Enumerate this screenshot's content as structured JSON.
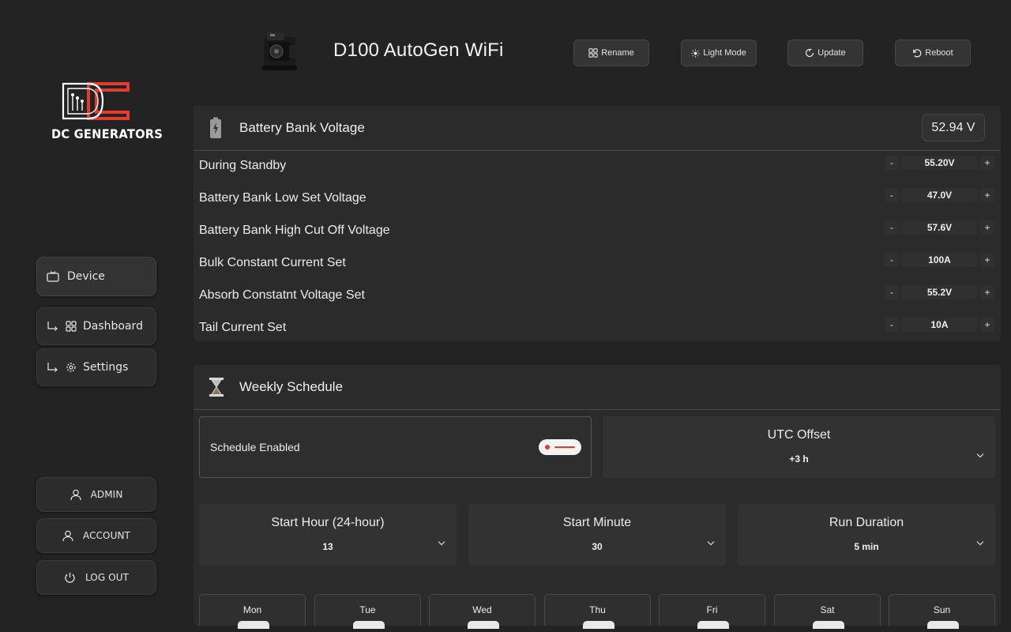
{
  "brand": {
    "name": "DC GENERATORS"
  },
  "nav": {
    "items": [
      {
        "label": "Device",
        "icon": "tv-icon"
      },
      {
        "label": "Dashboard",
        "icon": "grid-icon"
      },
      {
        "label": "Settings",
        "icon": "gear-icon"
      }
    ],
    "account": [
      {
        "label": "ADMIN",
        "icon": "user-icon"
      },
      {
        "label": "ACCOUNT",
        "icon": "user-icon"
      },
      {
        "label": "LOG OUT",
        "icon": "power-icon"
      }
    ]
  },
  "header": {
    "title": "D100 AutoGen WiFi",
    "buttons": [
      {
        "label": "Rename",
        "icon": "grid-icon"
      },
      {
        "label": "Light Mode",
        "icon": "sun-icon"
      },
      {
        "label": "Update",
        "icon": "refresh-icon"
      },
      {
        "label": "Reboot",
        "icon": "undo-icon"
      }
    ]
  },
  "battery": {
    "title": "Battery Bank Voltage",
    "current_voltage": "52.94 V",
    "settings": [
      {
        "label": "During Standby",
        "value": "55.20V"
      },
      {
        "label": "Battery Bank Low Set Voltage",
        "value": "47.0V"
      },
      {
        "label": "Battery Bank High Cut Off Voltage",
        "value": "57.6V"
      },
      {
        "label": "Bulk Constant Current Set",
        "value": "100A"
      },
      {
        "label": "Absorb Constatnt Voltage Set",
        "value": "55.2V"
      },
      {
        "label": "Tail Current Set",
        "value": "10A"
      }
    ],
    "minus": "-",
    "plus": "+"
  },
  "schedule": {
    "title": "Weekly Schedule",
    "enabled_label": "Schedule Enabled",
    "enabled": true,
    "utc": {
      "label": "UTC Offset",
      "value": "+3 h"
    },
    "start_hour": {
      "label": "Start Hour (24-hour)",
      "value": "13"
    },
    "start_minute": {
      "label": "Start Minute",
      "value": "30"
    },
    "run_duration": {
      "label": "Run Duration",
      "value": "5 min"
    },
    "days": [
      "Mon",
      "Tue",
      "Wed",
      "Thu",
      "Fri",
      "Sat",
      "Sun"
    ]
  },
  "colors": {
    "background": "#232323",
    "panel": "#2b2b2b",
    "accent": "#e53b2f",
    "text": "#e8e8e8"
  }
}
